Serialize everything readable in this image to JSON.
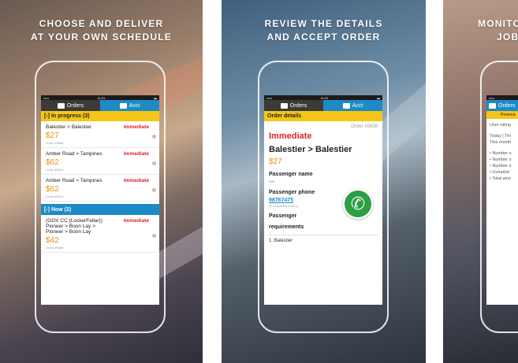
{
  "panels": [
    {
      "headline_line1": "CHOOSE AND DELIVER",
      "headline_line2": "AT YOUR OWN SCHEDULE",
      "status": {
        "carrier": "•••••",
        "time": "11:21",
        "battery": "▬"
      },
      "tabs": [
        {
          "label": "Orders"
        },
        {
          "label": "Acct"
        }
      ],
      "in_progress_label": "[-] In progress (3)",
      "in_progress_orders": [
        {
          "route": "Balestier > Balestier",
          "tag": "Immediate",
          "price": "$27",
          "order_no": "Order #5668"
        },
        {
          "route": "Amber Road > Tampines",
          "tag": "Immediate",
          "price": "$62",
          "order_no": "Order #5643"
        },
        {
          "route": "Amber Road > Tampines",
          "tag": "Immediate",
          "price": "$62",
          "order_no": "Order #5644"
        }
      ],
      "now_label": "[-] Now (2)",
      "now_order": {
        "route_line1": "(GGV CC (LockerFellar))",
        "tag": "Immediate",
        "route_line2": "Pioneer > Boon Lay >",
        "route_line3": "Pioneer > Boon Lay",
        "price": "$42",
        "order_no": "Order #5665"
      }
    },
    {
      "headline_line1": "REVIEW THE DETAILS",
      "headline_line2": "AND ACCEPT ORDER",
      "status": {
        "carrier": "•••••",
        "time": "11:21",
        "battery": "▬"
      },
      "tabs": [
        {
          "label": "Orders"
        },
        {
          "label": "Acct"
        }
      ],
      "section_label": "Order details",
      "order_no": "Order #5638",
      "tag": "Immediate",
      "route": "Balestier > Balestier",
      "price": "$27",
      "passenger_name_label": "Passenger name",
      "passenger_name_value": "sss",
      "passenger_phone_label": "Passenger phone",
      "phone": "98767475",
      "completed_orders": "(0 completed orders)",
      "requirements_label_1": "Passenger",
      "requirements_label_2": "requirements",
      "stop_1": "1. Balestier",
      "call_icon": "phone-icon"
    },
    {
      "headline_line1": "MONITO",
      "headline_line2": "JOB",
      "status": {
        "carrier": "•••••",
        "time": "11"
      },
      "tabs": [
        {
          "label": "Orders"
        }
      ],
      "section_label": "Persona",
      "lines": [
        "User rating",
        "Today | Thi",
        "This month",
        "• Number o",
        "• Number o",
        "• Number o",
        "• Completi",
        "• Total amo"
      ]
    }
  ],
  "colors": {
    "accent_blue": "#1d8ac7",
    "accent_yellow": "#f5c518",
    "price_orange": "#f28c18",
    "immediate_red": "#e0202a",
    "call_green": "#2e9e44"
  }
}
